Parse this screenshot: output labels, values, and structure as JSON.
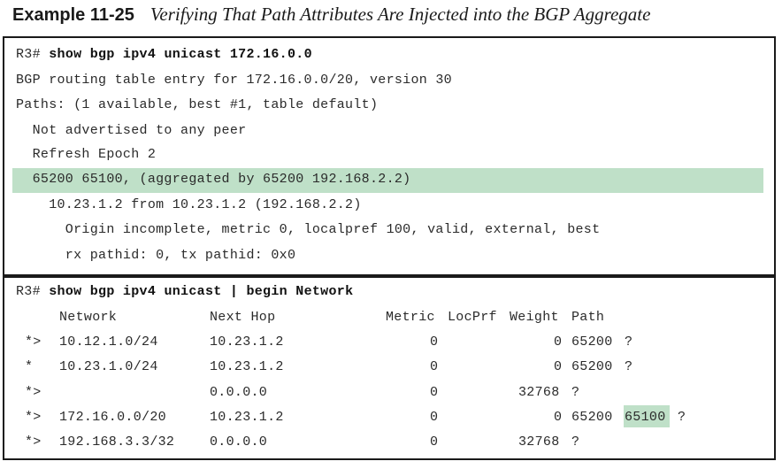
{
  "example": {
    "number": "Example 11-25",
    "title": "Verifying That Path Attributes Are Injected into the BGP Aggregate"
  },
  "block1": {
    "prompt": "R3#",
    "command": "show bgp ipv4 unicast 172.16.0.0",
    "lines": [
      "BGP routing table entry for 172.16.0.0/20, version 30",
      "Paths: (1 available, best #1, table default)",
      "  Not advertised to any peer",
      "  Refresh Epoch 2",
      "  65200 65100, (aggregated by 65200 192.168.2.2)",
      "    10.23.1.2 from 10.23.1.2 (192.168.2.2)",
      "      Origin incomplete, metric 0, localpref 100, valid, external, best",
      "      rx pathid: 0, tx pathid: 0x0"
    ]
  },
  "block2": {
    "prompt": "R3#",
    "command": "show bgp ipv4 unicast | begin Network",
    "headers": {
      "network": "Network",
      "next_hop": "Next Hop",
      "metric": "Metric",
      "locprf": "LocPrf",
      "weight": "Weight",
      "path": "Path"
    },
    "rows": [
      {
        "status": "*>",
        "network": "10.12.1.0/24",
        "next_hop": "10.23.1.2",
        "metric": "0",
        "weight": "0",
        "path_a": "65200",
        "path_b": "?"
      },
      {
        "status": "*",
        "network": "10.23.1.0/24",
        "next_hop": "10.23.1.2",
        "metric": "0",
        "weight": "0",
        "path_a": "65200",
        "path_b": "?"
      },
      {
        "status": "*>",
        "network": "",
        "next_hop": "0.0.0.0",
        "metric": "0",
        "weight": "32768",
        "path_a": "?",
        "path_b": ""
      },
      {
        "status": "*>",
        "network": "172.16.0.0/20",
        "next_hop": "10.23.1.2",
        "metric": "0",
        "weight": "0",
        "path_a": "65200",
        "path_hl": "65100",
        "path_b": "?"
      },
      {
        "status": "*>",
        "network": "192.168.3.3/32",
        "next_hop": "0.0.0.0",
        "metric": "0",
        "weight": "32768",
        "path_a": "?",
        "path_b": ""
      }
    ]
  },
  "colors": {
    "highlight": "#bfe0c8",
    "border": "#1a1a1a",
    "text": "#2a2a2a"
  }
}
